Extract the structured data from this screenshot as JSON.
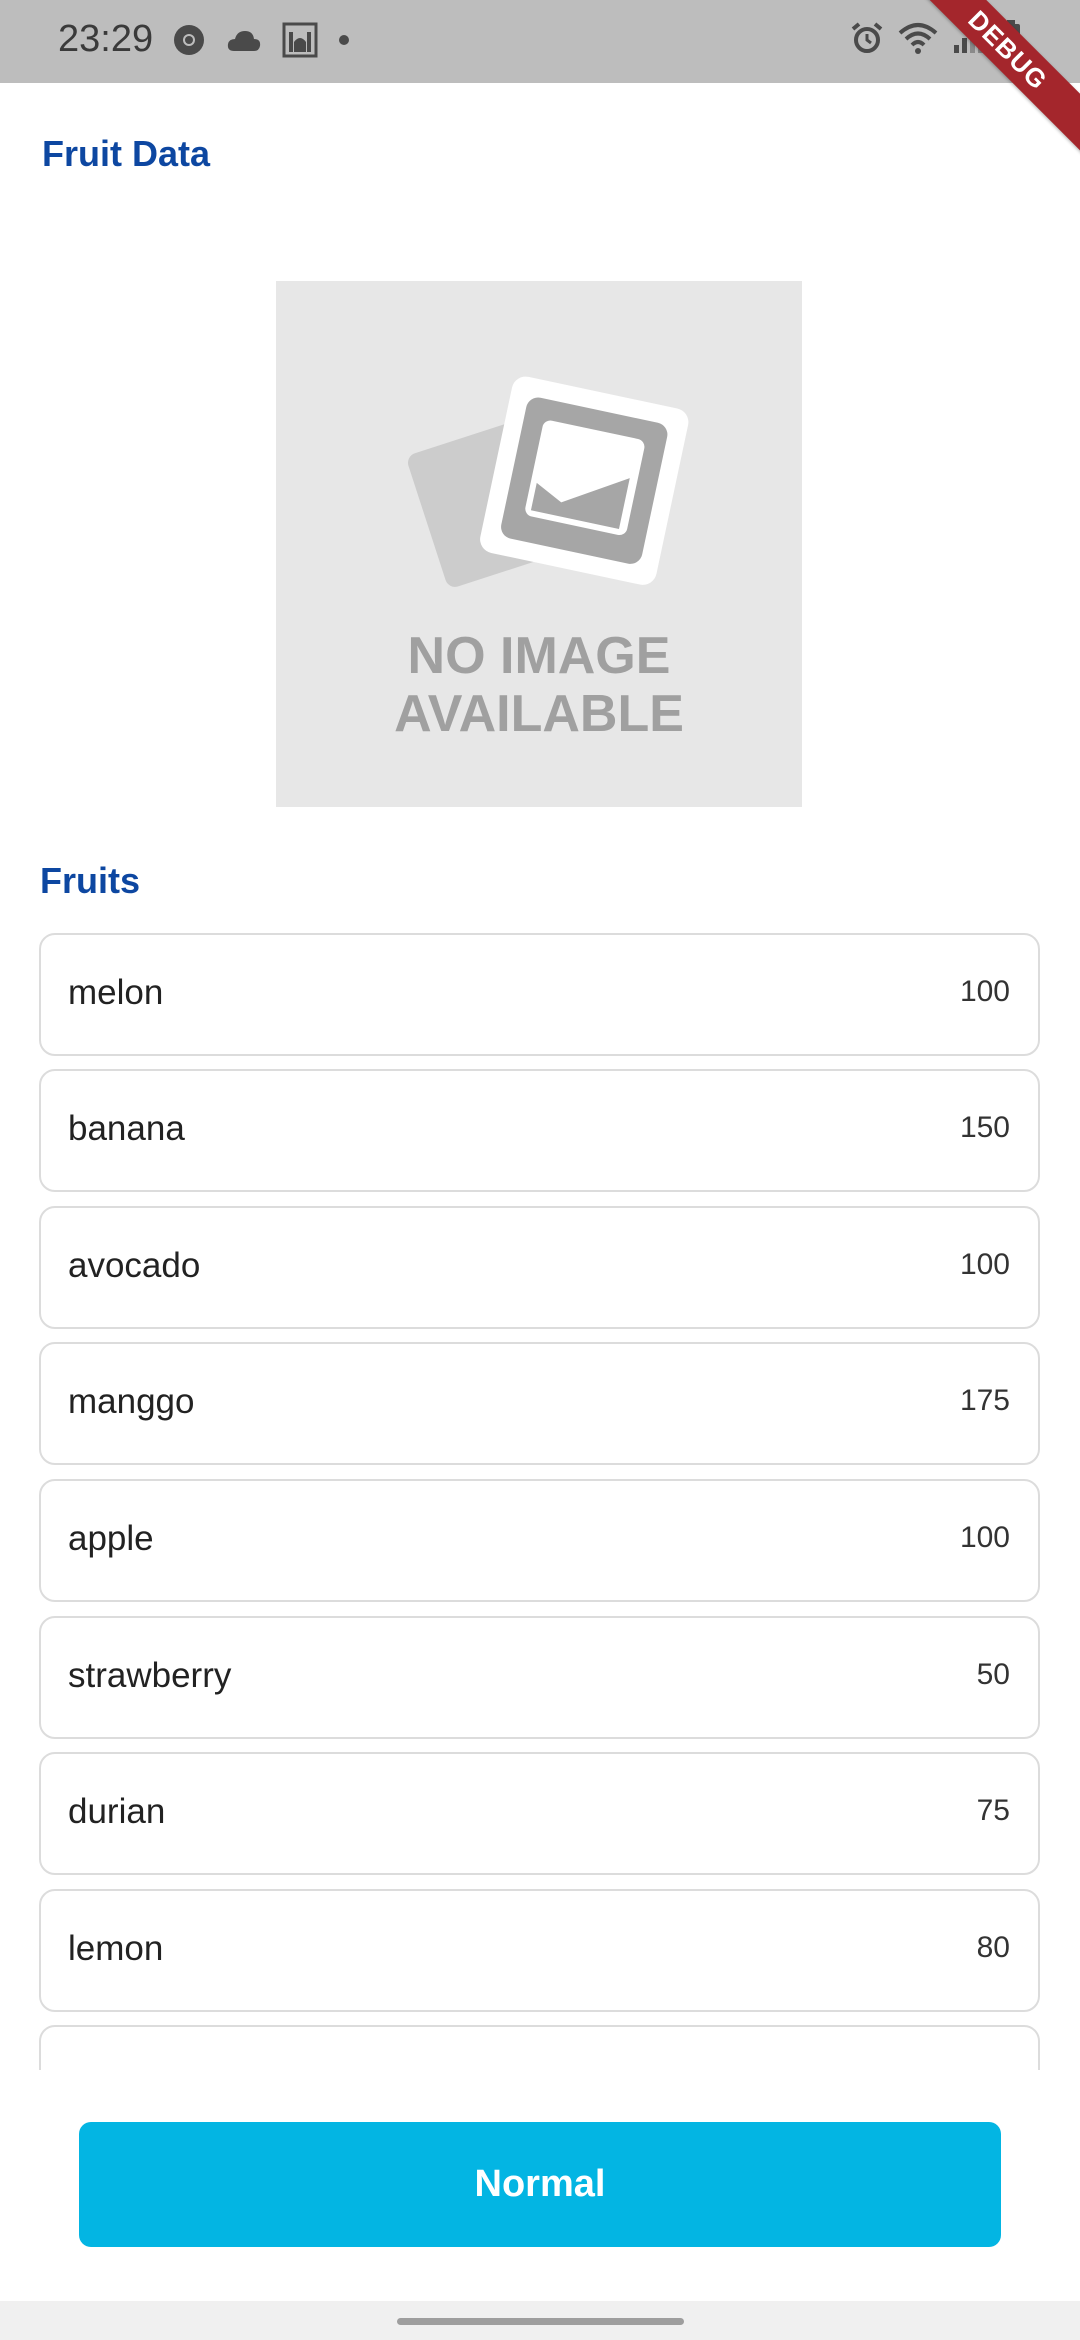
{
  "status_bar": {
    "time": "23:29",
    "left_icons": [
      "chrome-icon",
      "cloud-icon",
      "mosque-icon",
      "dot-icon"
    ],
    "right_icons": [
      "alarm-icon",
      "wifi-icon",
      "signal-icon",
      "battery-icon"
    ]
  },
  "debug_banner": "DEBUG",
  "header": {
    "title": "Fruit Data"
  },
  "placeholder_image": {
    "line1": "NO IMAGE",
    "line2": "AVAILABLE"
  },
  "section": {
    "title": "Fruits"
  },
  "fruits": [
    {
      "name": "melon",
      "value": "100"
    },
    {
      "name": "banana",
      "value": "150"
    },
    {
      "name": "avocado",
      "value": "100"
    },
    {
      "name": "manggo",
      "value": "175"
    },
    {
      "name": "apple",
      "value": "100"
    },
    {
      "name": "strawberry",
      "value": "50"
    },
    {
      "name": "durian",
      "value": "75"
    },
    {
      "name": "lemon",
      "value": "80"
    },
    {
      "name": "",
      "value": ""
    }
  ],
  "button": {
    "label": "Normal"
  },
  "colors": {
    "accent": "#03b5e3",
    "title": "#0d47a1",
    "debug": "#a4262c"
  }
}
